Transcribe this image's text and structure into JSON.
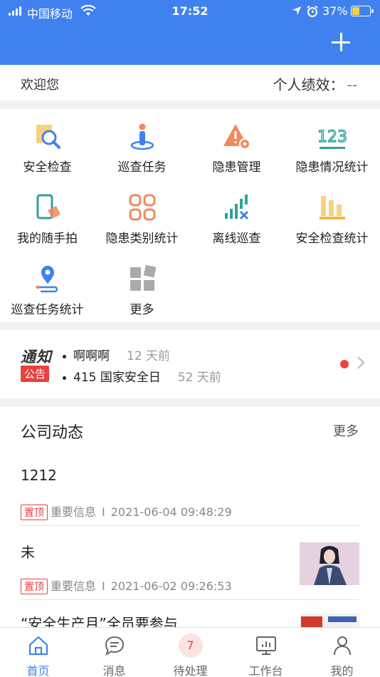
{
  "status_bar": {
    "carrier": "中国移动",
    "time": "17:52",
    "battery": "37%"
  },
  "welcome": {
    "greeting": "欢迎您",
    "perf_label": "个人绩效：",
    "perf_value": "--"
  },
  "grid": [
    {
      "label": "安全检查",
      "icon": "safety-check-icon"
    },
    {
      "label": "巡查任务",
      "icon": "patrol-task-icon"
    },
    {
      "label": "隐患管理",
      "icon": "hazard-warning-icon"
    },
    {
      "label": "隐患情况统计",
      "icon": "numbers-123-icon"
    },
    {
      "label": "我的随手拍",
      "icon": "phone-snapshot-icon"
    },
    {
      "label": "隐患类别统计",
      "icon": "category-grid-icon"
    },
    {
      "label": "离线巡查",
      "icon": "offline-signal-icon"
    },
    {
      "label": "安全检查统计",
      "icon": "bar-stats-icon"
    },
    {
      "label": "巡查任务统计",
      "icon": "location-pin-icon"
    },
    {
      "label": "更多",
      "icon": "more-blocks-icon"
    }
  ],
  "notice": {
    "tz": "通知",
    "gg": "公告",
    "items": [
      {
        "text": "啊啊啊",
        "ago": "12 天前"
      },
      {
        "text": "415 国家安全日",
        "ago": "52 天前"
      }
    ]
  },
  "news": {
    "title": "公司动态",
    "more": "更多",
    "items": [
      {
        "title": "1212",
        "pin": "置顶",
        "category": "重要信息",
        "sep": "I",
        "time": "2021-06-04 09:48:29"
      },
      {
        "title": "未",
        "pin": "置顶",
        "category": "重要信息",
        "sep": "I",
        "time": "2021-06-02 09:26:53"
      },
      {
        "title": "“安全生产月”全员要参与"
      }
    ]
  },
  "tabs": [
    {
      "label": "首页",
      "icon": "home-icon",
      "active": true
    },
    {
      "label": "消息",
      "icon": "message-icon"
    },
    {
      "label": "待处理",
      "icon": "pending-badge",
      "badge": "7"
    },
    {
      "label": "工作台",
      "icon": "workbench-icon"
    },
    {
      "label": "我的",
      "icon": "user-icon"
    }
  ],
  "colors": {
    "primary": "#3f82ef",
    "red": "#e8413e",
    "orange": "#f08a5d",
    "teal": "#2fa39a"
  }
}
